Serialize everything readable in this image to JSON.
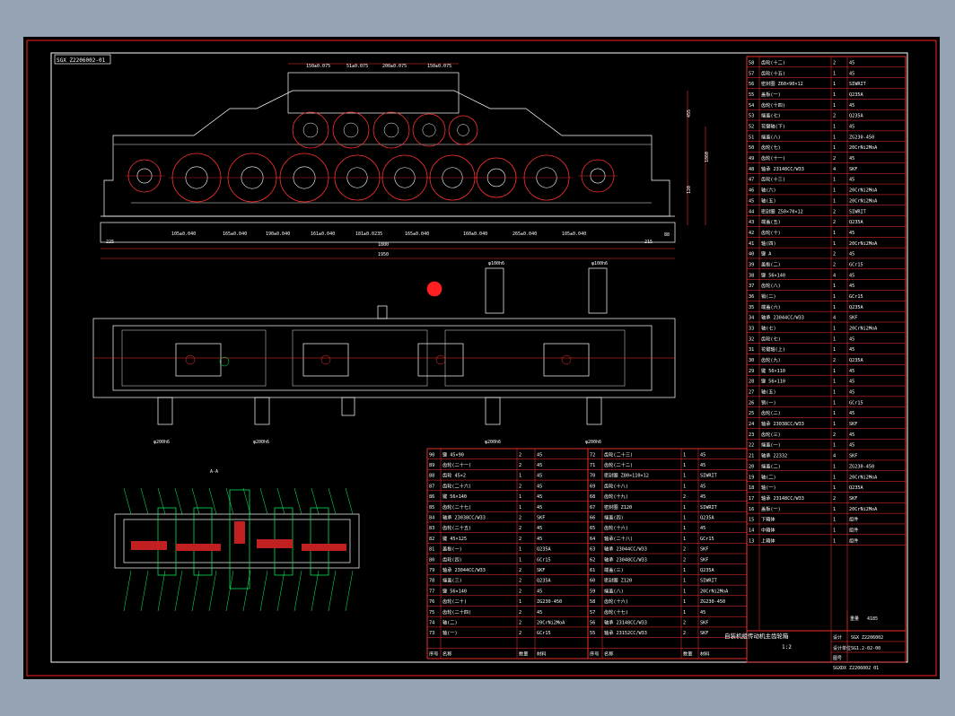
{
  "drawing": {
    "drawing_number": "SGX Z2206002-01",
    "title": "自装机组传动机主齿轮箱",
    "scale": "1:2",
    "number_code": "SGX Z2206002",
    "sheet_code": "SG1.2-02-00",
    "weight": "4185",
    "bottom_number": "SGXDX Z2206002 01",
    "sheet_marker": "01"
  },
  "dimensions": {
    "top_row": [
      "150±0.075",
      "51±0.075",
      "200±0.075",
      "150±0.075"
    ],
    "bottom_row": [
      "105±0.040",
      "165±0.040",
      "190±0.040",
      "161±0.040",
      "181±0.0235",
      "165±0.040",
      "160±0.040",
      "265±0.040",
      "105±0.040"
    ],
    "overall_1": "1800",
    "overall_2": "1950",
    "left_offset": "225",
    "right_offset": "215",
    "height_labels": [
      "455",
      "1860",
      "120",
      "88"
    ]
  },
  "view_labels": {
    "section": "A-A",
    "shaft_dims": [
      "φ100h6",
      "φ100h6",
      "φ200h6",
      "φ200h6",
      "φ200h6",
      "φ200h6"
    ]
  },
  "bom_right": [
    [
      "58",
      "齿轮(十二)",
      "2",
      "45"
    ],
    [
      "57",
      "齿轮(十五)",
      "1",
      "45"
    ],
    [
      "56",
      "密封圈 Z60×90×12",
      "1",
      "SIWRIT"
    ],
    [
      "55",
      "盖板(一)",
      "1",
      "Q235A"
    ],
    [
      "54",
      "齿轮(十四)",
      "1",
      "45"
    ],
    [
      "53",
      "端盖(七)",
      "2",
      "Q235A"
    ],
    [
      "52",
      "花键轴(下)",
      "1",
      "45"
    ],
    [
      "51",
      "端盖(八)",
      "1",
      "ZG230-450"
    ],
    [
      "50",
      "齿轮(七)",
      "1",
      "20CrNi2MoA"
    ],
    [
      "49",
      "齿轮(十一)",
      "2",
      "45"
    ],
    [
      "48",
      "轴承 23148CC/W33",
      "4",
      "SKF"
    ],
    [
      "47",
      "齿轮(十三)",
      "1",
      "45"
    ],
    [
      "46",
      "轴(六)",
      "1",
      "20CrNi2MoA"
    ],
    [
      "45",
      "轴(五)",
      "1",
      "20CrNi2MoA"
    ],
    [
      "44",
      "密封圈 Z50×70×12",
      "2",
      "SIWRIT"
    ],
    [
      "43",
      "端盖(五)",
      "2",
      "Q235A"
    ],
    [
      "42",
      "齿轮(十)",
      "1",
      "45"
    ],
    [
      "41",
      "轴(四)",
      "1",
      "20CrNi2MoA"
    ],
    [
      "40",
      "键 A",
      "2",
      "45"
    ],
    [
      "39",
      "盖板(二)",
      "2",
      "GCr15"
    ],
    [
      "38",
      "键 56×140",
      "4",
      "45"
    ],
    [
      "37",
      "齿轮(八)",
      "1",
      "45"
    ],
    [
      "36",
      "销(二)",
      "1",
      "GCr15"
    ],
    [
      "35",
      "端盖(六)",
      "1",
      "Q235A"
    ],
    [
      "34",
      "轴承 23044CC/W33",
      "4",
      "SKF"
    ],
    [
      "33",
      "轴(七)",
      "1",
      "20CrNi2MoA"
    ],
    [
      "32",
      "齿轮(七)",
      "1",
      "45"
    ],
    [
      "31",
      "花键轴(上)",
      "1",
      "45"
    ],
    [
      "30",
      "齿轮(九)",
      "2",
      "Q235A"
    ],
    [
      "29",
      "键 56×110",
      "1",
      "45"
    ],
    [
      "28",
      "键 56×110",
      "1",
      "45"
    ],
    [
      "27",
      "轴(五)",
      "1",
      "45"
    ],
    [
      "26",
      "销(一)",
      "1",
      "GCr15"
    ],
    [
      "25",
      "齿轮(二)",
      "1",
      "45"
    ],
    [
      "24",
      "轴承 23038CC/W33",
      "1",
      "SKF"
    ],
    [
      "23",
      "齿轮(三)",
      "2",
      "45"
    ],
    [
      "22",
      "端盖(一)",
      "1",
      "45"
    ],
    [
      "21",
      "轴承 22332",
      "4",
      "SKF"
    ],
    [
      "20",
      "端盖(二)",
      "1",
      "ZG230-450"
    ],
    [
      "19",
      "轴(二)",
      "1",
      "20CrNi2MoA"
    ],
    [
      "18",
      "轴(一)",
      "1",
      "Q235A"
    ],
    [
      "17",
      "轴承 23148CC/W33",
      "2",
      "SKF"
    ],
    [
      "16",
      "盖板(一)",
      "1",
      "20CrNi2MoA"
    ],
    [
      "15",
      "下箱体",
      "1",
      "组件"
    ],
    [
      "14",
      "中箱体",
      "1",
      "组件"
    ],
    [
      "13",
      "上箱体",
      "1",
      "组件"
    ]
  ],
  "bom_bottom_left": [
    [
      "90",
      "键 45×90",
      "2",
      "45"
    ],
    [
      "89",
      "齿轮(二十一)",
      "2",
      "45"
    ],
    [
      "88",
      "齿轮 45×2",
      "1",
      "45"
    ],
    [
      "87",
      "齿轮(二十六)",
      "2",
      "45"
    ],
    [
      "86",
      "键 56×140",
      "1",
      "45"
    ],
    [
      "85",
      "齿轮(二十七)",
      "1",
      "45"
    ],
    [
      "84",
      "轴承 23038CC/W33",
      "2",
      "SKF"
    ],
    [
      "83",
      "齿轮(二十五)",
      "2",
      "45"
    ],
    [
      "82",
      "键 45×125",
      "2",
      "45"
    ],
    [
      "81",
      "盖板(一)",
      "1",
      "Q235A"
    ],
    [
      "80",
      "齿轮(四)",
      "1",
      "GCr15"
    ],
    [
      "79",
      "轴承 23044CC/W33",
      "2",
      "SKF"
    ],
    [
      "78",
      "端盖(三)",
      "2",
      "Q235A"
    ],
    [
      "77",
      "键 56×140",
      "2",
      "45"
    ],
    [
      "76",
      "齿轮(二十)",
      "1",
      "ZG230-450"
    ],
    [
      "75",
      "齿轮(二十四)",
      "2",
      "45"
    ],
    [
      "74",
      "轴(二)",
      "2",
      "20CrNi2MoA"
    ],
    [
      "73",
      "轴(一)",
      "2",
      "GCr15"
    ]
  ],
  "bom_bottom_mid": [
    [
      "72",
      "齿轮(二十三)",
      "1",
      "45"
    ],
    [
      "71",
      "齿轮(二十二)",
      "1",
      "45"
    ],
    [
      "70",
      "密封圈 Z80×110×12",
      "1",
      "SIWRIT"
    ],
    [
      "69",
      "齿轮(十八)",
      "1",
      "45"
    ],
    [
      "68",
      "齿轮(十九)",
      "2",
      "45"
    ],
    [
      "67",
      "密封圈 Z120",
      "1",
      "SIWRIT"
    ],
    [
      "66",
      "端盖(四)",
      "1",
      "Q235A"
    ],
    [
      "65",
      "齿轮(十六)",
      "1",
      "45"
    ],
    [
      "64",
      "轴承(二十八)",
      "1",
      "GCr15"
    ],
    [
      "63",
      "轴承 23044CC/W33",
      "2",
      "SKF"
    ],
    [
      "62",
      "轴承 23048CC/W33",
      "2",
      "SKF"
    ],
    [
      "61",
      "端盖(三)",
      "1",
      "Q235A"
    ],
    [
      "60",
      "密封圈 Z120",
      "1",
      "SIWRIT"
    ],
    [
      "59",
      "端盖(八)",
      "1",
      "20CrNi2MoA"
    ],
    [
      "58",
      "齿轮(十六)",
      "1",
      "ZG230-450"
    ],
    [
      "57",
      "齿轮(十七)",
      "1",
      "45"
    ],
    [
      "56",
      "轴承 23148CC/W33",
      "2",
      "SKF"
    ],
    [
      "55",
      "轴承 23152CC/W33",
      "2",
      "SKF"
    ]
  ],
  "bom_headers": [
    "序号",
    "名称",
    "数量",
    "材料",
    "备注"
  ],
  "title_block": {
    "drawn_label": "设计",
    "checked_label": "审核",
    "weight_label": "重量",
    "scale_label": "比例",
    "material_label": "材料",
    "sheet_label": "共 张",
    "number_label": "图号",
    "company_label": "设计单位"
  }
}
